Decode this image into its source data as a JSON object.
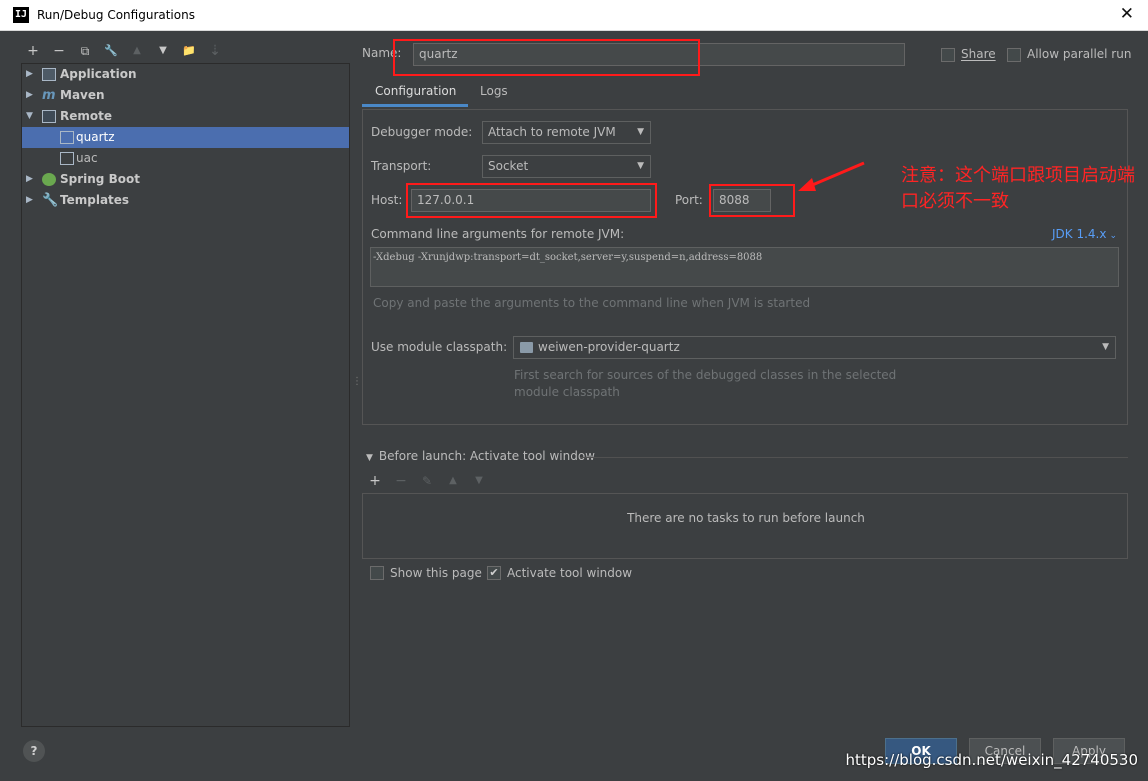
{
  "window": {
    "title": "Run/Debug Configurations",
    "app_icon": "IJ",
    "close_glyph": "✕"
  },
  "left_toolbar": {
    "add": "+",
    "remove": "−",
    "copy": "⧉",
    "edit_defaults": "🔧",
    "move_up": "▲",
    "move_down": "▼",
    "folder": "📁",
    "sort": "⇣"
  },
  "tree": {
    "items": [
      {
        "label": "Application",
        "icon": "application-icon"
      },
      {
        "label": "Maven",
        "icon": "maven-icon"
      },
      {
        "label": "Remote",
        "icon": "remote-icon"
      },
      {
        "label": "quartz",
        "icon": "remote-config-icon"
      },
      {
        "label": "uac",
        "icon": "remote-config-icon"
      },
      {
        "label": "Spring Boot",
        "icon": "spring-boot-icon"
      },
      {
        "label": "Templates",
        "icon": "wrench-icon"
      }
    ]
  },
  "form": {
    "name_label": "Name:",
    "name_value": "quartz",
    "share_label": "Share",
    "parallel_label": "Allow parallel run",
    "tabs": [
      "Configuration",
      "Logs"
    ],
    "debugger_mode_label": "Debugger mode:",
    "debugger_mode_value": "Attach to remote JVM",
    "transport_label": "Transport:",
    "transport_value": "Socket",
    "host_label": "Host:",
    "host_value": "127.0.0.1",
    "port_label": "Port:",
    "port_value": "8088",
    "cmd_label": "Command line arguments for remote JVM:",
    "jdk_link": "JDK 1.4.x",
    "cmd_value": "-Xdebug -Xrunjdwp:transport=dt_socket,server=y,suspend=n,address=8088",
    "cmd_hint": "Copy and paste the arguments to the command line when JVM is started",
    "classpath_label": "Use module classpath:",
    "classpath_value": "weiwen-provider-quartz",
    "classpath_hint_1": "First search for sources of the debugged classes in the selected",
    "classpath_hint_2": "module classpath"
  },
  "before_launch": {
    "title": "Before launch: Activate tool window",
    "empty_text": "There are no tasks to run before launch",
    "show_page_label": "Show this page",
    "activate_label": "Activate tool window"
  },
  "buttons": {
    "help": "?",
    "ok": "OK",
    "cancel": "Cancel",
    "apply": "Apply"
  },
  "annotation": {
    "note": "注意：这个端口跟项目启动端口必须不一致"
  },
  "watermark": "https://blog.csdn.net/weixin_42740530",
  "colors": {
    "accent": "#4b6eaf",
    "annotation": "#ff1a1a",
    "link": "#589df6"
  }
}
